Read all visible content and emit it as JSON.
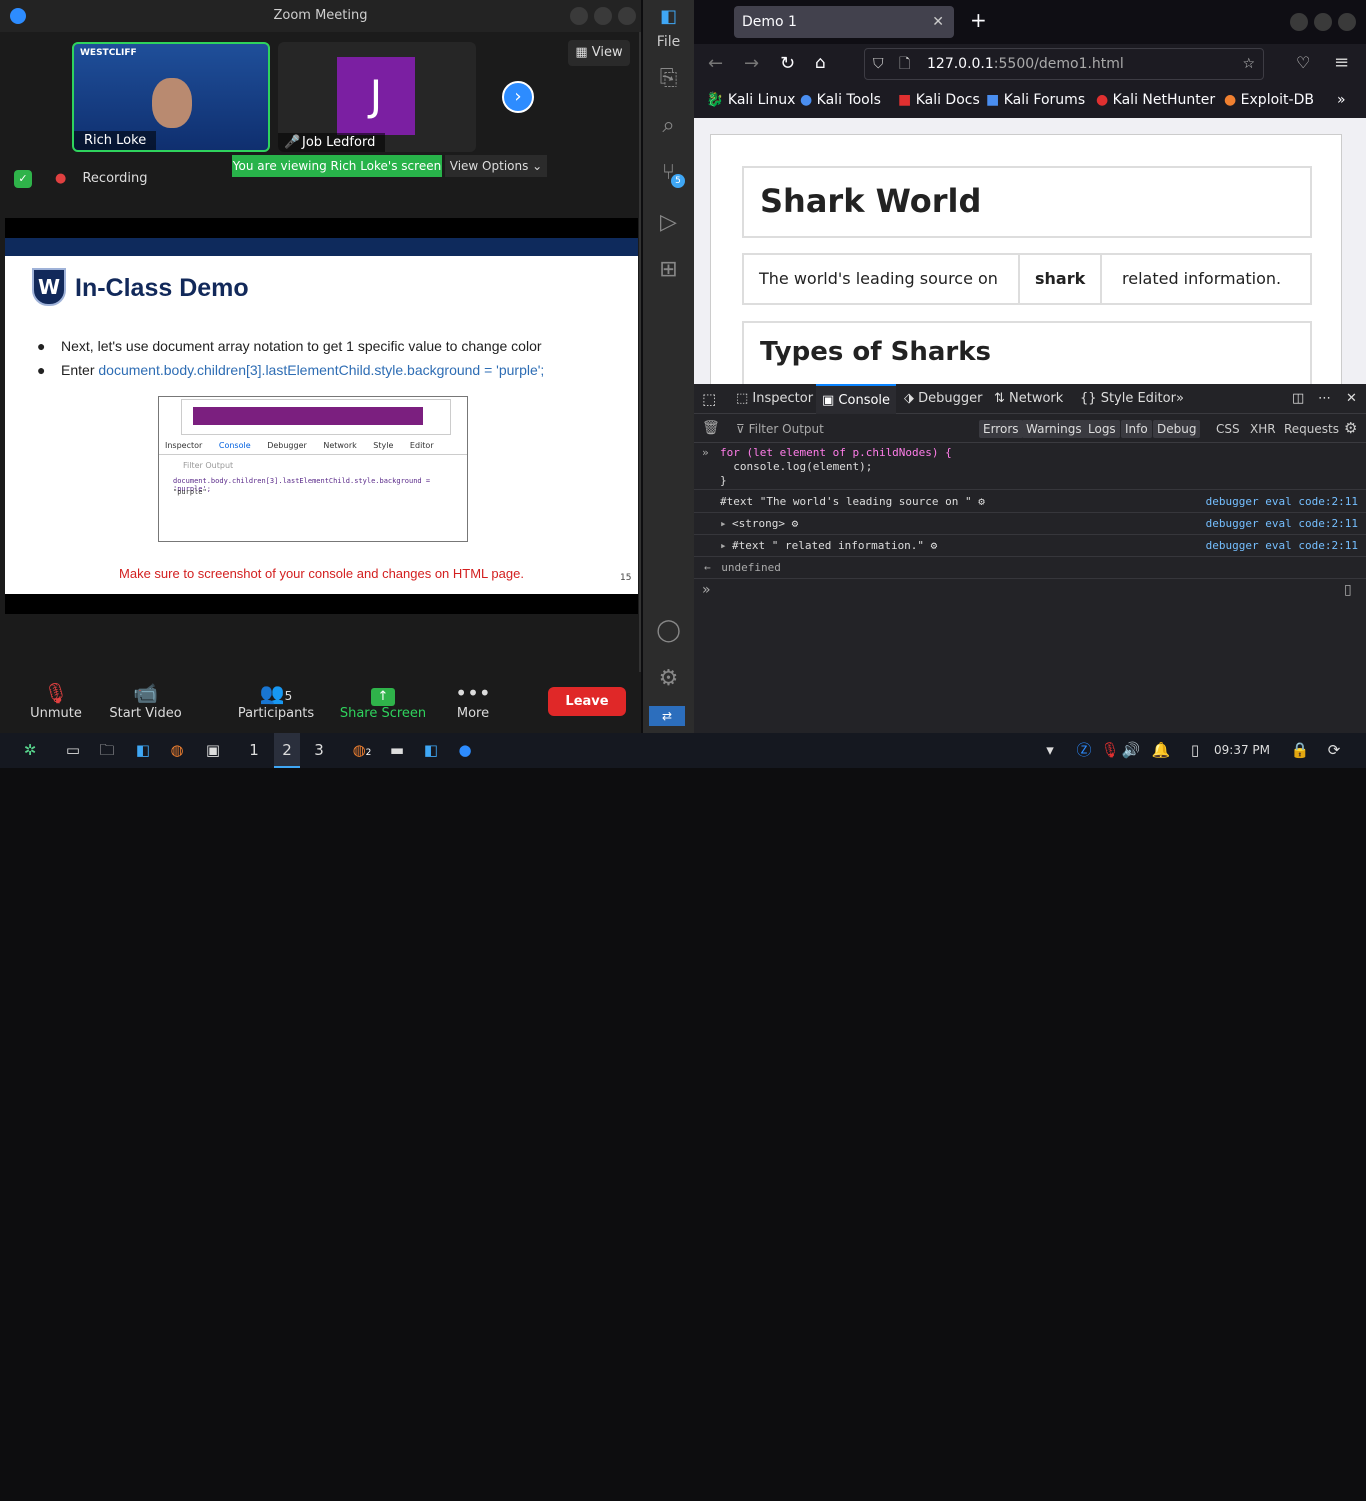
{
  "zoom": {
    "title": "Zoom Meeting",
    "participants_tiles": [
      {
        "name": "Rich Loke"
      },
      {
        "name": "Job Ledford",
        "initial": "J"
      }
    ],
    "view_label": "View",
    "banner": "You are viewing Rich Loke's screen",
    "view_options": "View Options",
    "recording": "Recording",
    "toolbar": {
      "unmute": "Unmute",
      "start_video": "Start Video",
      "participants": "Participants",
      "participants_count": "5",
      "share": "Share Screen",
      "more": "More",
      "leave": "Leave"
    }
  },
  "slide": {
    "title": "In-Class Demo",
    "bullet1": "Next, let's use document array notation to get 1 specific value to change color",
    "bullet2_prefix": "Enter ",
    "bullet2_code": "document.body.children[3].lastElementChild.style.background = 'purple';",
    "inner_tabs": [
      "Inspector",
      "Console",
      "Debugger",
      "Network",
      "Style Editor"
    ],
    "inner_filter": "Filter Output",
    "inner_cmd": "document.body.children[3].lastElementChild.style.background = 'purple';",
    "inner_result": "\"purple\"",
    "note": "Make sure to screenshot of your console and changes on HTML page.",
    "page_number": "15"
  },
  "vscode": {
    "menu": "File",
    "scm_badge": "5"
  },
  "firefox": {
    "tab_title": "Demo 1",
    "url_host": "127.0.0.1",
    "url_rest": ":5500/demo1.html",
    "bookmarks": [
      "Kali Linux",
      "Kali Tools",
      "Kali Docs",
      "Kali Forums",
      "Kali NetHunter",
      "Exploit-DB"
    ],
    "page": {
      "h1": "Shark World",
      "p_before": "The world's leading source on",
      "p_strong": "shark",
      "p_after": "related information.",
      "h2": "Types of Sharks"
    },
    "devtools": {
      "tabs": [
        "Inspector",
        "Console",
        "Debugger",
        "Network",
        "Style Editor"
      ],
      "filter_placeholder": "Filter Output",
      "filter_buttons": [
        "Errors",
        "Warnings",
        "Logs",
        "Info",
        "Debug"
      ],
      "filter_types": [
        "CSS",
        "XHR",
        "Requests"
      ],
      "input_lines": [
        "for (let element of p.childNodes) {",
        "  console.log(element);",
        "}"
      ],
      "logs": [
        {
          "text": "#text \"The world's leading source on \"",
          "source": "debugger eval code:2:11"
        },
        {
          "text": "<strong>",
          "source": "debugger eval code:2:11"
        },
        {
          "text": "#text \" related information.\"",
          "source": "debugger eval code:2:11"
        }
      ],
      "result": "undefined"
    }
  },
  "taskbar": {
    "workspaces": [
      "1",
      "2",
      "3"
    ],
    "firefox_badge": "2",
    "clock": "09:37 PM"
  }
}
